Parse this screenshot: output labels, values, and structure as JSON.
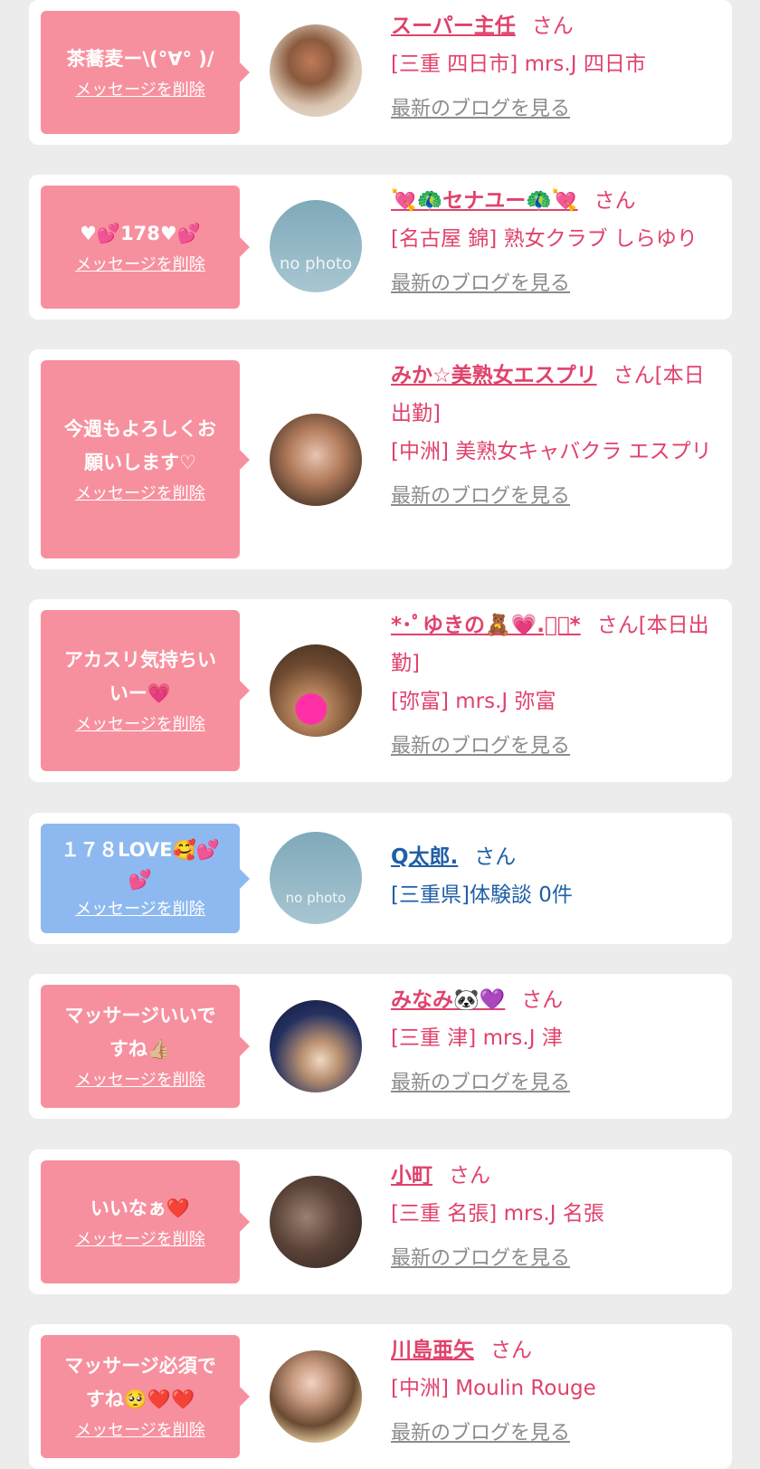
{
  "colors": {
    "pink_bubble": "#f7909e",
    "blue_bubble": "#8db9f0",
    "name_pink": "#e0426b",
    "name_blue": "#1f5fa6",
    "link_gray": "#8c8c8c"
  },
  "labels": {
    "delete": "メッセージを削除",
    "blog": "最新のブログを見る"
  },
  "cards": [
    {
      "message": "茶蕎麦ー\\(°∀° )/",
      "name": "スーパー主任",
      "suffix": "さん",
      "shop": "[三重 四日市] mrs.J 四日市",
      "blog": "最新のブログを見る"
    },
    {
      "message": "♥💕178♥💕",
      "name": "💘🦚セナユー🦚💘",
      "suffix": "さん",
      "shop": "[名古屋 錦] 熟女クラブ しらゆり",
      "blog": "最新のブログを見る",
      "avatar_text": "no photo"
    },
    {
      "message": "今週もよろしくお\n願いします♡",
      "name": "みか☆美熟女エスプリ",
      "suffix": "さん[本日出勤]",
      "shop": "[中洲] 美熟女キャバクラ エスプリ",
      "blog": "最新のブログを見る"
    },
    {
      "message": "アカスリ気持ちい\nいー💗",
      "name": "*･ﾟゆきの🧸💗.ﾟ･*",
      "suffix": "さん[本日出勤]",
      "shop": "[弥富] mrs.J 弥富",
      "blog": "最新のブログを見る"
    },
    {
      "message": "１７８LOVE🥰💕\n💕",
      "name": "Q太郎.",
      "suffix": "さん",
      "shop": "[三重県]体験談 0件",
      "avatar_text": "no photo"
    },
    {
      "message": "マッサージいいで\nすね👍🏼",
      "name": "みなみ🐼💜",
      "suffix": "さん",
      "shop": "[三重 津] mrs.J 津",
      "blog": "最新のブログを見る"
    },
    {
      "message": "いいなぁ❤️",
      "name": "小町",
      "suffix": "さん",
      "shop": "[三重 名張] mrs.J 名張",
      "blog": "最新のブログを見る"
    },
    {
      "message": "マッサージ必須で\nすね🥺❤️❤️",
      "name": "川島亜矢",
      "suffix": "さん",
      "shop": "[中洲] Moulin Rouge",
      "blog": "最新のブログを見る"
    }
  ]
}
